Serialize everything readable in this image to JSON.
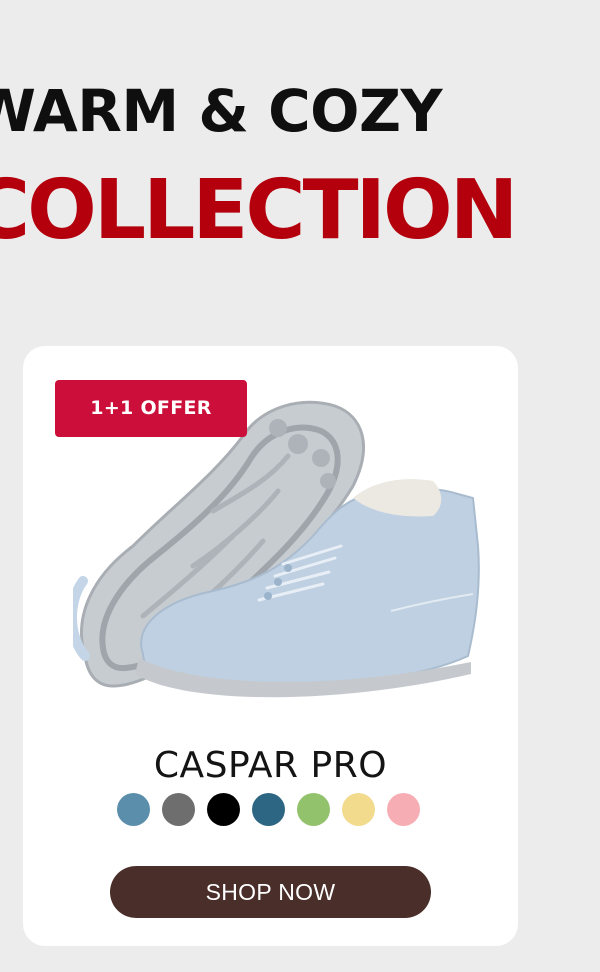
{
  "hero": {
    "line1": "WARM & COZY",
    "line2": "COLLECTION"
  },
  "product": {
    "badge": "1+1 OFFER",
    "name": "CASPAR PRO",
    "image_alt": "light blue barefoot winter shoe",
    "swatches": [
      {
        "name": "steel blue",
        "color": "#5a8eab"
      },
      {
        "name": "grey",
        "color": "#6e6e6e"
      },
      {
        "name": "black",
        "color": "#000000"
      },
      {
        "name": "dark teal",
        "color": "#2d6683"
      },
      {
        "name": "green",
        "color": "#93c26c"
      },
      {
        "name": "sand yellow",
        "color": "#f3db8e"
      },
      {
        "name": "pink",
        "color": "#f6adb3"
      }
    ],
    "cta_label": "SHOP NOW"
  },
  "colors": {
    "page_bg": "#ececec",
    "hero_dark": "#0f0f0f",
    "hero_red": "#b3000c",
    "badge": "#cc0e3a",
    "button": "#4a2e29",
    "card": "#ffffff"
  }
}
